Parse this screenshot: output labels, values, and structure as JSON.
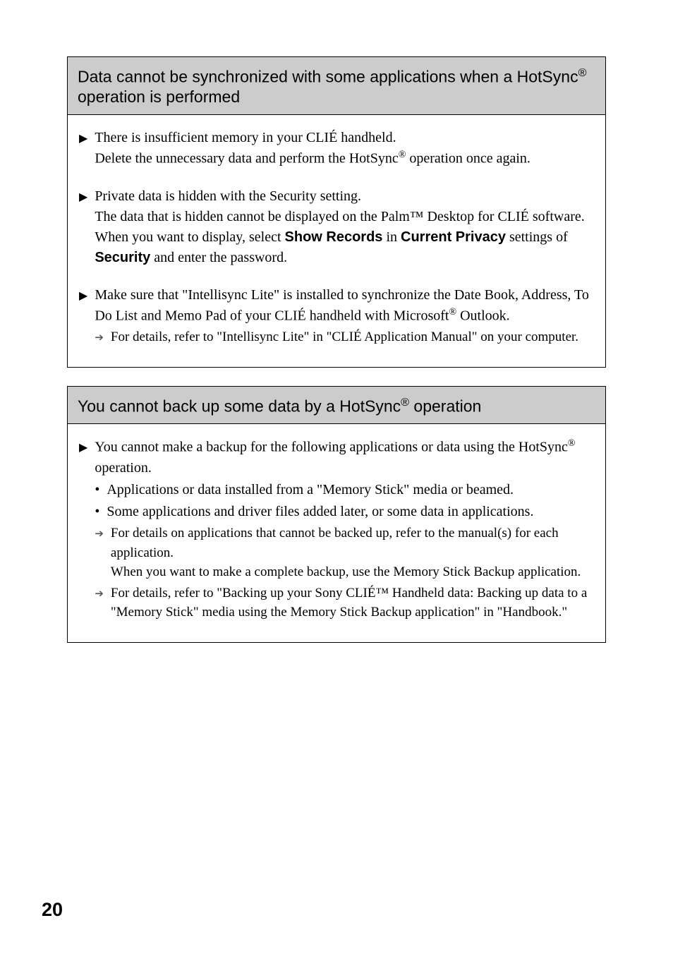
{
  "section1": {
    "title_l1": "Data cannot be synchronized with some applications when a HotSync",
    "title_sup": "®",
    "title_l2": " operation is performed",
    "item1_line1": "There is insufficient memory in your CLIÉ handheld.",
    "item1_line2a": "Delete the unnecessary data and perform the HotSync",
    "item1_sup": "®",
    "item1_line2b": " operation once again.",
    "item2_line1": "Private data is hidden with the Security setting.",
    "item2_line2a": "The data that is hidden cannot be displayed on the Palm™ Desktop for CLIÉ software. When you want to display, select ",
    "item2_bold1": "Show Records",
    "item2_line2b": " in ",
    "item2_bold2": "Current Privacy",
    "item2_line2c": " settings of ",
    "item2_bold3": "Security",
    "item2_line2d": " and enter the password.",
    "item3_line1a": "Make sure that \"Intellisync Lite\" is installed to synchronize the Date Book, Address, To Do List and Memo Pad of your CLIÉ handheld with Microsoft",
    "item3_sup": "®",
    "item3_line1b": " Outlook.",
    "item3_arrow": "For details, refer to \"Intellisync Lite\" in \"CLIÉ Application Manual\" on your computer."
  },
  "section2": {
    "title_a": "You cannot back up some data by a HotSync",
    "title_sup": "®",
    "title_b": " operation",
    "item1_line1a": "You cannot make a backup for the following applications or data using the HotSync",
    "item1_sup": "®",
    "item1_line1b": " operation.",
    "bullet1": "Applications or data installed from a \"Memory Stick\" media or beamed.",
    "bullet2": "Some applications and driver files added later, or some data in applications.",
    "arrow1": "For details on applications that cannot be backed up, refer to the manual(s) for each application.",
    "arrow1_sub": "When you want to make a complete backup, use the Memory Stick Backup application.",
    "arrow2": "For details, refer to \"Backing up your Sony CLIÉ™ Handheld data: Backing up data to a \"Memory Stick\" media using the Memory Stick Backup application\" in \"Handbook.\""
  },
  "page_number": "20"
}
